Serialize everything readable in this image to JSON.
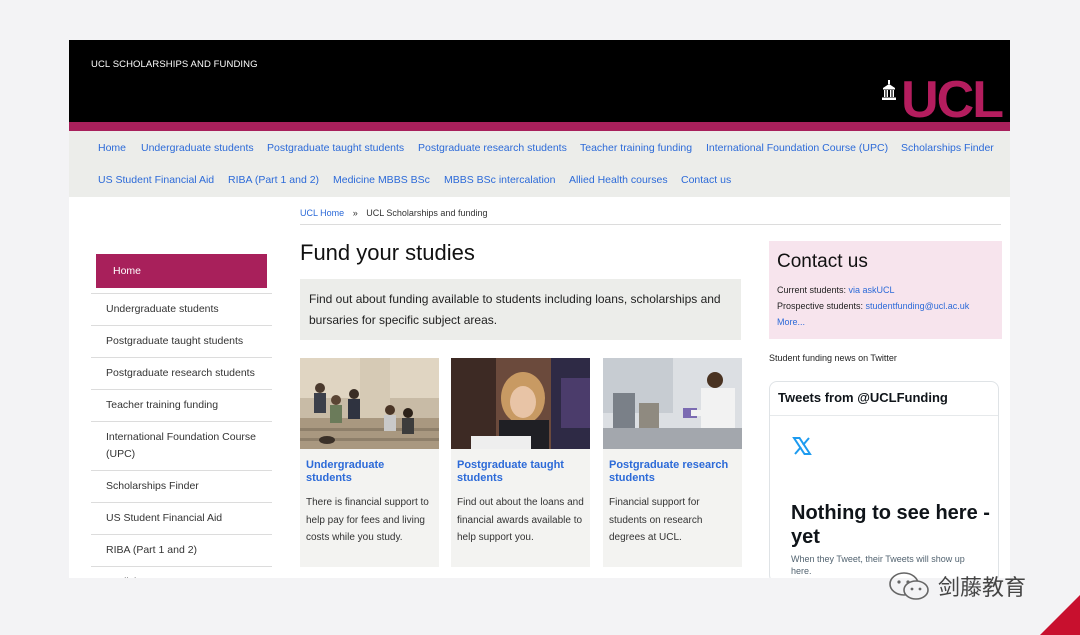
{
  "header": {
    "site_title": "UCL SCHOLARSHIPS AND FUNDING",
    "logo_text": "UCL"
  },
  "topnav": {
    "row1": [
      "Home",
      "Undergraduate students",
      "Postgraduate taught students",
      "Postgraduate research students",
      "Teacher training funding",
      "International Foundation Course (UPC)",
      "Scholarships Finder"
    ],
    "row2": [
      "US Student Financial Aid",
      "RIBA (Part 1 and 2)",
      "Medicine MBBS BSc",
      "MBBS BSc intercalation",
      "Allied Health courses",
      "Contact us"
    ]
  },
  "breadcrumb": {
    "home": "UCL Home",
    "separator": "»",
    "current": "UCL Scholarships and funding"
  },
  "sidenav": {
    "active": "Home",
    "items": [
      "Undergraduate students",
      "Postgraduate taught students",
      "Postgraduate research students",
      "Teacher training funding",
      "International Foundation Course (UPC)",
      "Scholarships Finder",
      "US Student Financial Aid",
      "RIBA (Part 1 and 2)",
      "Medicine MBBS BSc"
    ]
  },
  "main": {
    "title": "Fund your studies",
    "intro": "Find out about funding available to students including loans, scholarships and bursaries for specific subject areas.",
    "cards": [
      {
        "title": "Undergraduate students",
        "desc": "There is financial support to help pay for fees and living costs while you study."
      },
      {
        "title": "Postgraduate taught students",
        "desc": "Find out about the loans and financial awards available to help support you."
      },
      {
        "title": "Postgraduate research students",
        "desc": "Financial support for students on research degrees at UCL."
      }
    ]
  },
  "contact": {
    "title": "Contact us",
    "current_label": "Current students: ",
    "current_link": "via askUCL",
    "prospective_label": "Prospective students: ",
    "prospective_link": "studentfunding@ucl.ac.uk",
    "more": "More..."
  },
  "twitter": {
    "label": "Student funding news on Twitter",
    "header": "Tweets from @UCLFunding",
    "empty_title": "Nothing to see here - yet",
    "empty_desc": "When they Tweet, their Tweets will show up here."
  },
  "watermark": {
    "text": "剑藤教育"
  },
  "colors": {
    "brand": "#a8205b",
    "link": "#2c6ad8",
    "header_bg": "#000000",
    "contact_bg": "#f7e4ed"
  }
}
